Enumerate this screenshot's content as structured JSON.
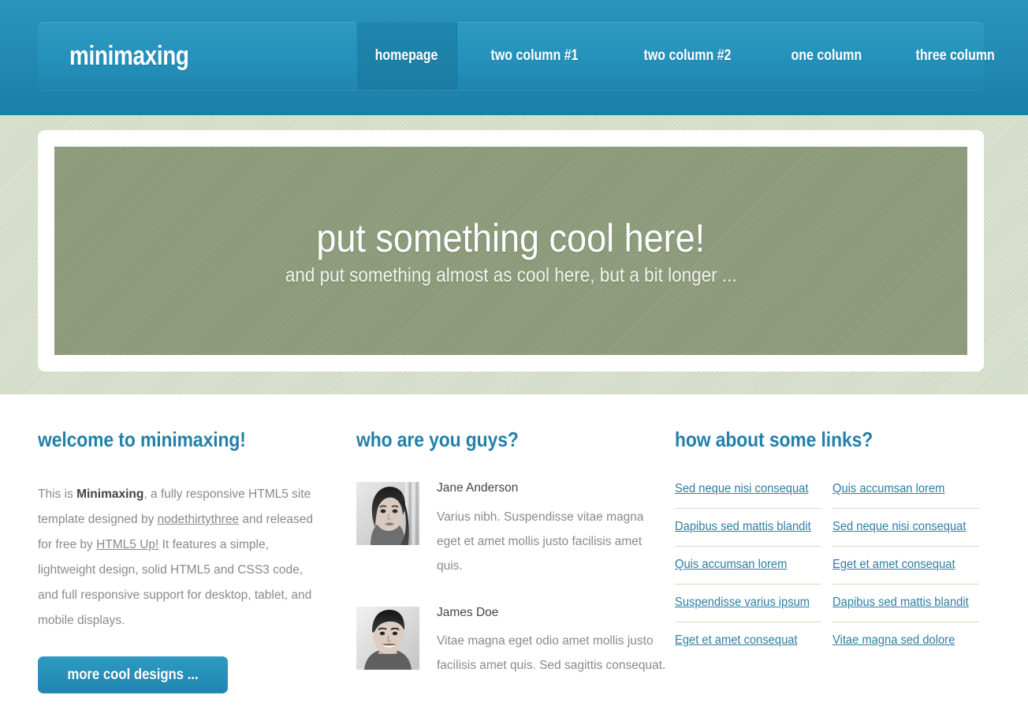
{
  "colors": {
    "header_blue": "#2491ba",
    "header_blue_dark": "#1b7fa6",
    "active_tab": "#1f87ae",
    "band_green": "#d6dfca",
    "banner_green": "#8f9d7c",
    "heading_teal": "#2380a8",
    "body_gray": "#8a8a8a",
    "link_blue": "#2d7fa3",
    "rule_khaki": "#ded9bd"
  },
  "header": {
    "logo": "minimaxing",
    "nav": [
      {
        "label": "homepage",
        "active": true
      },
      {
        "label": "two column #1",
        "active": false
      },
      {
        "label": "two column #2",
        "active": false
      },
      {
        "label": "one column",
        "active": false
      },
      {
        "label": "three column",
        "active": false
      }
    ]
  },
  "banner": {
    "title": "put something cool here!",
    "subtitle": "and put something almost as cool here, but a bit longer ..."
  },
  "welcome": {
    "title": "welcome to minimaxing!",
    "text_part1": "This is ",
    "brand": "Minimaxing",
    "text_part2": ", a fully responsive HTML5 site template designed by ",
    "link1": "nodethirtythree",
    "text_part3": " and released for free by ",
    "link2": "HTML5 Up!",
    "text_part4": " It features a simple, lightweight design, solid HTML5 and CSS3 code, and full responsive support for desktop, tablet, and mobile displays.",
    "button": "more cool designs ..."
  },
  "people": {
    "title": "who are you guys?",
    "items": [
      {
        "name": "Jane Anderson",
        "desc": "Varius nibh. Suspendisse vitae magna eget et amet mollis justo facilisis amet quis.",
        "avatar": "avatar-jane-anderson"
      },
      {
        "name": "James Doe",
        "desc": "Vitae magna eget odio amet mollis justo facilisis amet quis. Sed sagittis consequat.",
        "avatar": "avatar-james-doe"
      }
    ]
  },
  "links": {
    "title": "how about some links?",
    "column_left": [
      "Sed neque nisi consequat",
      "Dapibus sed mattis blandit",
      "Quis accumsan lorem",
      "Suspendisse varius ipsum",
      "Eget et amet consequat"
    ],
    "column_right": [
      "Quis accumsan lorem",
      "Sed neque nisi consequat",
      "Eget et amet consequat",
      "Dapibus sed mattis blandit",
      "Vitae magna sed dolore"
    ]
  }
}
